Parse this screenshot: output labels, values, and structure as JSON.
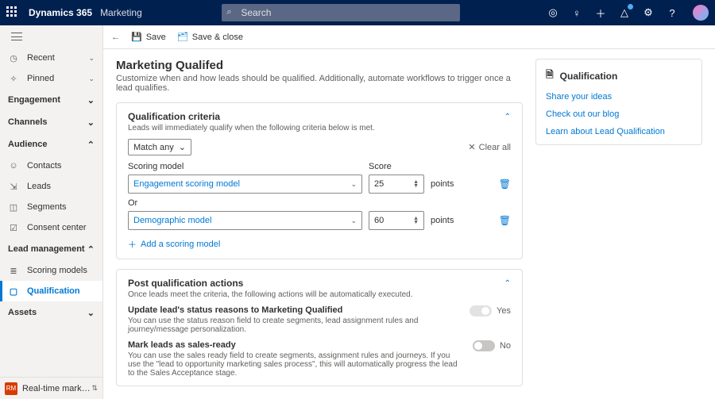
{
  "topbar": {
    "brand": "Dynamics 365",
    "module": "Marketing",
    "searchPlaceholder": "Search"
  },
  "nav": {
    "recent": "Recent",
    "pinned": "Pinned",
    "engagement": "Engagement",
    "channels": "Channels",
    "audience": "Audience",
    "contacts": "Contacts",
    "leads": "Leads",
    "segments": "Segments",
    "consent": "Consent center",
    "leadMgmt": "Lead management",
    "scoringModels": "Scoring models",
    "qualification": "Qualification",
    "assets": "Assets",
    "areaSwitcher": "Real-time marketi…"
  },
  "cmdbar": {
    "save": "Save",
    "saveClose": "Save & close"
  },
  "page": {
    "title": "Marketing Qualifed",
    "desc": "Customize when and how leads should be qualified. Additionally, automate workflows to trigger once a lead qualifies."
  },
  "criteria": {
    "title": "Qualification criteria",
    "desc": "Leads will immediately qualify when the following criteria below is met.",
    "match": "Match any",
    "clear": "Clear all",
    "scoringModelLabel": "Scoring model",
    "scoreLabel": "Score",
    "or": "Or",
    "unit": "points",
    "rows": [
      {
        "model": "Engagement scoring model",
        "score": "25"
      },
      {
        "model": "Demographic model",
        "score": "60"
      }
    ],
    "addLink": "Add a scoring model"
  },
  "actions": {
    "title": "Post qualification actions",
    "desc": "Once leads meet the criteria, the following actions will be automatically executed.",
    "row1title": "Update lead's status reasons to Marketing Qualified",
    "row1desc": "You can use the status reason field to create segments, lead assignment rules and journey/message personalization.",
    "row1toggle": "Yes",
    "row2title": "Mark leads as sales-ready",
    "row2desc": "You can use the sales ready field to create segments, assignment rules and journeys. If you use the \"lead to opportunity marketing sales process\", this will automatically progress the lead to the Sales Acceptance stage.",
    "row2toggle": "No"
  },
  "side": {
    "title": "Qualification",
    "links": [
      "Share your ideas",
      "Check out our blog",
      "Learn about Lead Qualification"
    ]
  }
}
